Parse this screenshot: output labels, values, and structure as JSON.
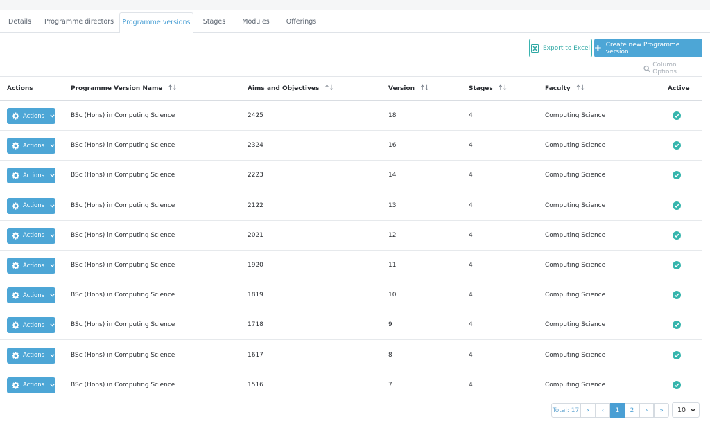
{
  "tabs": [
    {
      "label": "Details"
    },
    {
      "label": "Programme directors"
    },
    {
      "label": "Programme versions"
    },
    {
      "label": "Stages"
    },
    {
      "label": "Modules"
    },
    {
      "label": "Offerings"
    }
  ],
  "active_tab": "Programme versions",
  "toolbar": {
    "export_label": "Export to Excel",
    "create_label": "Create new Programme version",
    "column_options_label": "Column Options"
  },
  "table": {
    "headers": {
      "actions": "Actions",
      "name": "Programme Version Name",
      "aims": "Aims and Objectives",
      "version": "Version",
      "stages": "Stages",
      "faculty": "Faculty",
      "active": "Active"
    },
    "action_button_label": "Actions",
    "rows": [
      {
        "name": "BSc (Hons) in Computing Science",
        "aims": "2425",
        "version": "18",
        "stages": "4",
        "faculty": "Computing Science",
        "active": true
      },
      {
        "name": "BSc (Hons) in Computing Science",
        "aims": "2324",
        "version": "16",
        "stages": "4",
        "faculty": "Computing Science",
        "active": true
      },
      {
        "name": "BSc (Hons) in Computing Science",
        "aims": "2223",
        "version": "14",
        "stages": "4",
        "faculty": "Computing Science",
        "active": true
      },
      {
        "name": "BSc (Hons) in Computing Science",
        "aims": "2122",
        "version": "13",
        "stages": "4",
        "faculty": "Computing Science",
        "active": true
      },
      {
        "name": "BSc (Hons) in Computing Science",
        "aims": "2021",
        "version": "12",
        "stages": "4",
        "faculty": "Computing Science",
        "active": true
      },
      {
        "name": "BSc (Hons) in Computing Science",
        "aims": "1920",
        "version": "11",
        "stages": "4",
        "faculty": "Computing Science",
        "active": true
      },
      {
        "name": "BSc (Hons) in Computing Science",
        "aims": "1819",
        "version": "10",
        "stages": "4",
        "faculty": "Computing Science",
        "active": true
      },
      {
        "name": "BSc (Hons) in Computing Science",
        "aims": "1718",
        "version": "9",
        "stages": "4",
        "faculty": "Computing Science",
        "active": true
      },
      {
        "name": "BSc (Hons) in Computing Science",
        "aims": "1617",
        "version": "8",
        "stages": "4",
        "faculty": "Computing Science",
        "active": true
      },
      {
        "name": "BSc (Hons) in Computing Science",
        "aims": "1516",
        "version": "7",
        "stages": "4",
        "faculty": "Computing Science",
        "active": true
      }
    ]
  },
  "pagination": {
    "total_label": "Total: 17",
    "first": "«",
    "prev": "‹",
    "pages": [
      "1",
      "2"
    ],
    "current_page": "1",
    "next": "›",
    "last": "»",
    "page_size": "10"
  },
  "colors": {
    "accent": "#4da6d6",
    "teal": "#35b5ad",
    "tab_active": "#4a9fd4"
  },
  "icons": {
    "sort": "sort-arrows-icon",
    "gear": "gear-icon",
    "chevron": "chevron-down-icon",
    "check": "check-circle-icon",
    "excel": "excel-icon",
    "plus": "plus-icon",
    "search": "search-icon"
  }
}
